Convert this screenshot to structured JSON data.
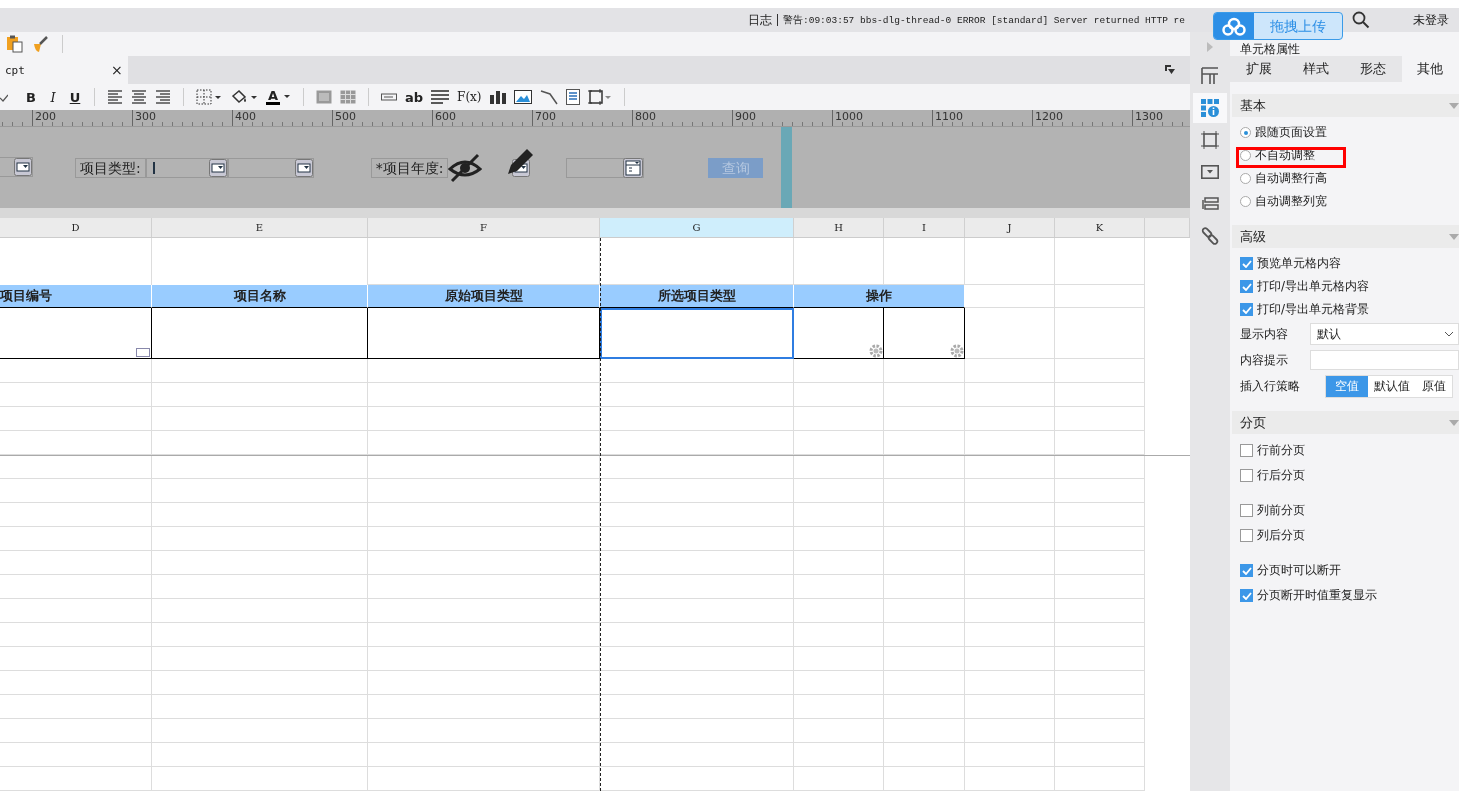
{
  "top_bar": {
    "log_label": "日志",
    "log_message": "警告:09:03:57 bbs-dlg-thread-0 ERROR [standard] Server returned HTTP re",
    "login": "未登录"
  },
  "upload_button": {
    "label": "拖拽上传"
  },
  "tab": {
    "label": "cpt",
    "selected": true,
    "close": "×"
  },
  "format_toolbar": {
    "bold": "B",
    "italic": "I",
    "underline": "U",
    "font_color": "A",
    "text_glyph": "ab",
    "formula": "F(x)"
  },
  "ruler": {
    "ticks": [
      "200",
      "300",
      "400",
      "500",
      "600",
      "700",
      "800",
      "900",
      "1000",
      "1100",
      "1200",
      "1300"
    ]
  },
  "parameter_panel": {
    "type_label": "项目类型:",
    "year_label": "*项目年度:",
    "query_button": "查询"
  },
  "sheet": {
    "columns": [
      {
        "name": "D",
        "selected": false
      },
      {
        "name": "E",
        "selected": false
      },
      {
        "name": "F",
        "selected": false
      },
      {
        "name": "G",
        "selected": true
      },
      {
        "name": "H",
        "selected": false
      },
      {
        "name": "I",
        "selected": false
      },
      {
        "name": "J",
        "selected": false
      },
      {
        "name": "K",
        "selected": false
      }
    ],
    "headers": [
      "项目编号",
      "项目名称",
      "原始项目类型",
      "所选项目类型",
      "操作"
    ]
  },
  "side_strip": [
    {
      "kind": "layout",
      "selected": false
    },
    {
      "kind": "cell",
      "selected": true
    },
    {
      "kind": "border",
      "selected": false
    },
    {
      "kind": "widget",
      "selected": false
    },
    {
      "kind": "condition",
      "selected": false
    },
    {
      "kind": "link",
      "selected": false
    }
  ],
  "side_panel": {
    "title": "单元格属性",
    "tabs": [
      {
        "label": "扩展",
        "selected": false
      },
      {
        "label": "样式",
        "selected": false
      },
      {
        "label": "形态",
        "selected": false
      },
      {
        "label": "其他",
        "selected": true
      }
    ],
    "basic": {
      "title": "基本",
      "options": [
        {
          "label": "跟随页面设置",
          "selected": true
        },
        {
          "label": "不自动调整",
          "selected": false
        },
        {
          "label": "自动调整行高",
          "selected": false
        },
        {
          "label": "自动调整列宽",
          "selected": false
        }
      ]
    },
    "advanced": {
      "title": "高级",
      "checks": [
        {
          "label": "预览单元格内容",
          "checked": true
        },
        {
          "label": "打印/导出单元格内容",
          "checked": true
        },
        {
          "label": "打印/导出单元格背景",
          "checked": true
        }
      ],
      "display_label": "显示内容",
      "display_value": "默认",
      "hint_label": "内容提示",
      "insert_label": "插入行策略",
      "insert_options": [
        {
          "label": "空值",
          "selected": true
        },
        {
          "label": "默认值",
          "selected": false
        },
        {
          "label": "原值",
          "selected": false
        }
      ]
    },
    "paging": {
      "title": "分页",
      "groups": [
        [
          {
            "label": "行前分页",
            "checked": false
          },
          {
            "label": "行后分页",
            "checked": false
          }
        ],
        [
          {
            "label": "列前分页",
            "checked": false
          },
          {
            "label": "列后分页",
            "checked": false
          }
        ],
        [
          {
            "label": "分页时可以断开",
            "checked": true
          },
          {
            "label": "分页断开时值重复显示",
            "checked": true
          }
        ]
      ]
    }
  }
}
